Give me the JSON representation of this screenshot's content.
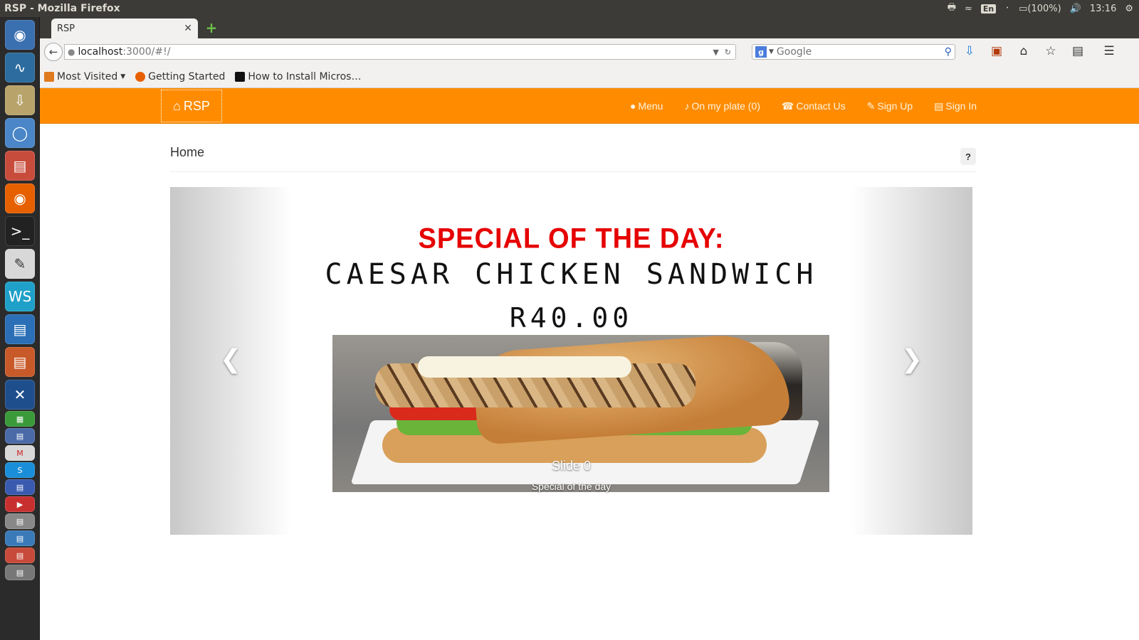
{
  "os": {
    "window_title": "RSP - Mozilla Firefox",
    "keyboard_layout": "En",
    "battery": "(100%)",
    "clock": "13:16"
  },
  "browser": {
    "tab_title": "RSP",
    "url_host": "localhost",
    "url_path": ":3000/#!/",
    "search_placeholder": "Google",
    "bookmarks": [
      {
        "label": "Most Visited",
        "icon": "folder-icon",
        "color": "#e07a1e"
      },
      {
        "label": "Getting Started",
        "icon": "firefox-icon",
        "color": "#e66000"
      },
      {
        "label": "How to Install Micros…",
        "icon": "l-site-icon",
        "color": "#111111"
      }
    ]
  },
  "app": {
    "accent": "#ff8c00",
    "brand": "RSP",
    "nav": [
      {
        "label": "Menu",
        "icon": "apple-icon"
      },
      {
        "label": "On my plate (0)",
        "icon": "cutlery-icon"
      },
      {
        "label": "Contact Us",
        "icon": "phone-icon"
      },
      {
        "label": "Sign Up",
        "icon": "pencil-icon"
      },
      {
        "label": "Sign In",
        "icon": "lock-icon"
      }
    ],
    "page_title": "Home",
    "help_label": "?"
  },
  "carousel": {
    "headline": "SPECIAL OF THE DAY:",
    "dish": "CAESAR CHICKEN SANDWICH",
    "price": "R40.00",
    "caption_title": "Slide 0",
    "caption_text": "Special of the day",
    "headline_color": "#e60000"
  }
}
